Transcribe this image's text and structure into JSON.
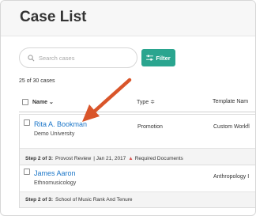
{
  "header": {
    "title": "Case List"
  },
  "search": {
    "placeholder": "Search cases",
    "icon": "search-icon"
  },
  "filter": {
    "label": "Filter",
    "icon": "sliders-icon",
    "color": "#2aa58f"
  },
  "summary": {
    "count_text": "25 of 30 cases"
  },
  "columns": {
    "name": "Name",
    "name_sort": "⌄",
    "type": "Type",
    "type_sort": "≑",
    "template": "Template Nam"
  },
  "cases": [
    {
      "name": "Rita A. Bookman",
      "unit": "Demo University",
      "type": "Promotion",
      "template": "Custom Workfl",
      "step_label": "Step 2 of 3:",
      "step_text": "Provost Review",
      "date": "| Jan 21, 2017",
      "alert": "Required Documents"
    },
    {
      "name": "James Aaron",
      "unit": "Ethnomusicology",
      "type": "",
      "template": "Anthropology I",
      "step_label": "Step 2 of 3:",
      "step_text": "School of Music Rank And Tenure"
    }
  ],
  "colors": {
    "link": "#1b76c8",
    "arrow": "#d9552a",
    "warning": "#d9534f"
  }
}
